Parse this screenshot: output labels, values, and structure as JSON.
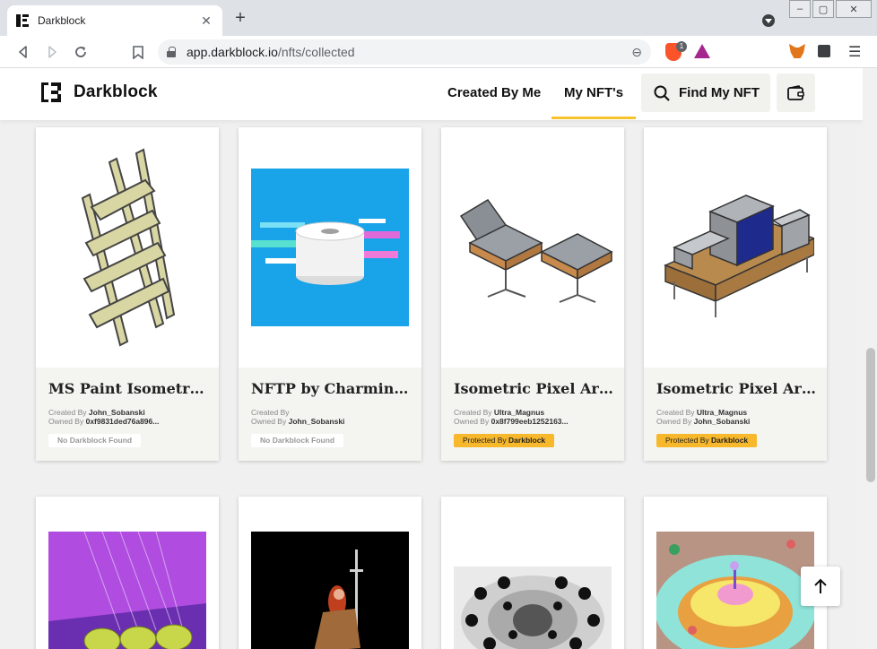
{
  "browser": {
    "tab_title": "Darkblock",
    "url_host": "app.darkblock.io",
    "url_path": "/nfts/collected",
    "brave_badge": "1"
  },
  "site": {
    "brand": "Darkblock",
    "nav": {
      "created_by_me": "Created By Me",
      "my_nfts": "My NFT's",
      "find_my_nft": "Find My NFT"
    }
  },
  "cards": [
    {
      "title": "MS Paint Isometric P...",
      "created_label": "Created By",
      "creator": "John_Sobanski",
      "owned_label": "Owned By",
      "owner": "0xf9831ded76a896...",
      "badge": "No Darkblock Found",
      "protected": false
    },
    {
      "title": "NFTP by Charmin / ...",
      "created_label": "Created By",
      "creator": "",
      "owned_label": "Owned By",
      "owner": "John_Sobanski",
      "badge": "No Darkblock Found",
      "protected": false
    },
    {
      "title": "Isometric Pixel Art - ...",
      "created_label": "Created By",
      "creator": "Ultra_Magnus",
      "owned_label": "Owned By",
      "owner": "0x8f799eeb1252163...",
      "badge_prefix": "Protected By",
      "badge_brand": "Darkblock",
      "protected": true
    },
    {
      "title": "Isometric Pixel Art - ...",
      "created_label": "Created By",
      "creator": "Ultra_Magnus",
      "owned_label": "Owned By",
      "owner": "John_Sobanski",
      "badge_prefix": "Protected By",
      "badge_brand": "Darkblock",
      "protected": true
    }
  ],
  "colors": {
    "accent": "#f7c22c",
    "protected_badge": "#f7b82c"
  }
}
